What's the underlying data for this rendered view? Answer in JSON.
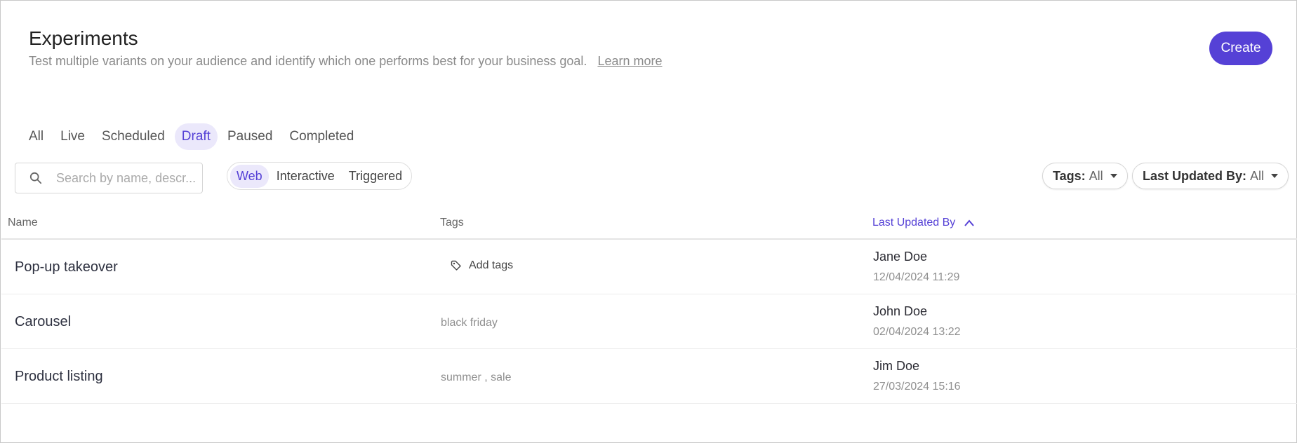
{
  "header": {
    "title": "Experiments",
    "subtitle": "Test multiple variants on your audience and identify which one performs best for your business goal.",
    "learn_more": "Learn more",
    "create_label": "Create"
  },
  "status_tabs": [
    {
      "label": "All"
    },
    {
      "label": "Live"
    },
    {
      "label": "Scheduled"
    },
    {
      "label": "Draft",
      "active": true
    },
    {
      "label": "Paused"
    },
    {
      "label": "Completed"
    }
  ],
  "search": {
    "placeholder": "Search by name, descr..."
  },
  "type_toggle": [
    {
      "label": "Web",
      "active": true
    },
    {
      "label": "Interactive"
    },
    {
      "label": "Triggered"
    }
  ],
  "filters": {
    "tags_label": "Tags:",
    "tags_value": "All",
    "updated_label": "Last Updated By:",
    "updated_value": "All"
  },
  "table": {
    "columns": [
      "Name",
      "Tags",
      "Last Updated By"
    ],
    "sorted_column": "Last Updated By",
    "add_tags_label": "Add tags",
    "rows": [
      {
        "name": "Pop-up takeover",
        "tags": "",
        "user": "Jane Doe",
        "date": "12/04/2024 11:29"
      },
      {
        "name": "Carousel",
        "tags": "black friday",
        "user": "John Doe",
        "date": "02/04/2024 13:22"
      },
      {
        "name": "Product listing",
        "tags": "summer , sale",
        "user": "Jim Doe",
        "date": "27/03/2024 15:16"
      }
    ]
  },
  "colors": {
    "accent": "#5541d6",
    "accent_light": "#ebe8fb"
  }
}
